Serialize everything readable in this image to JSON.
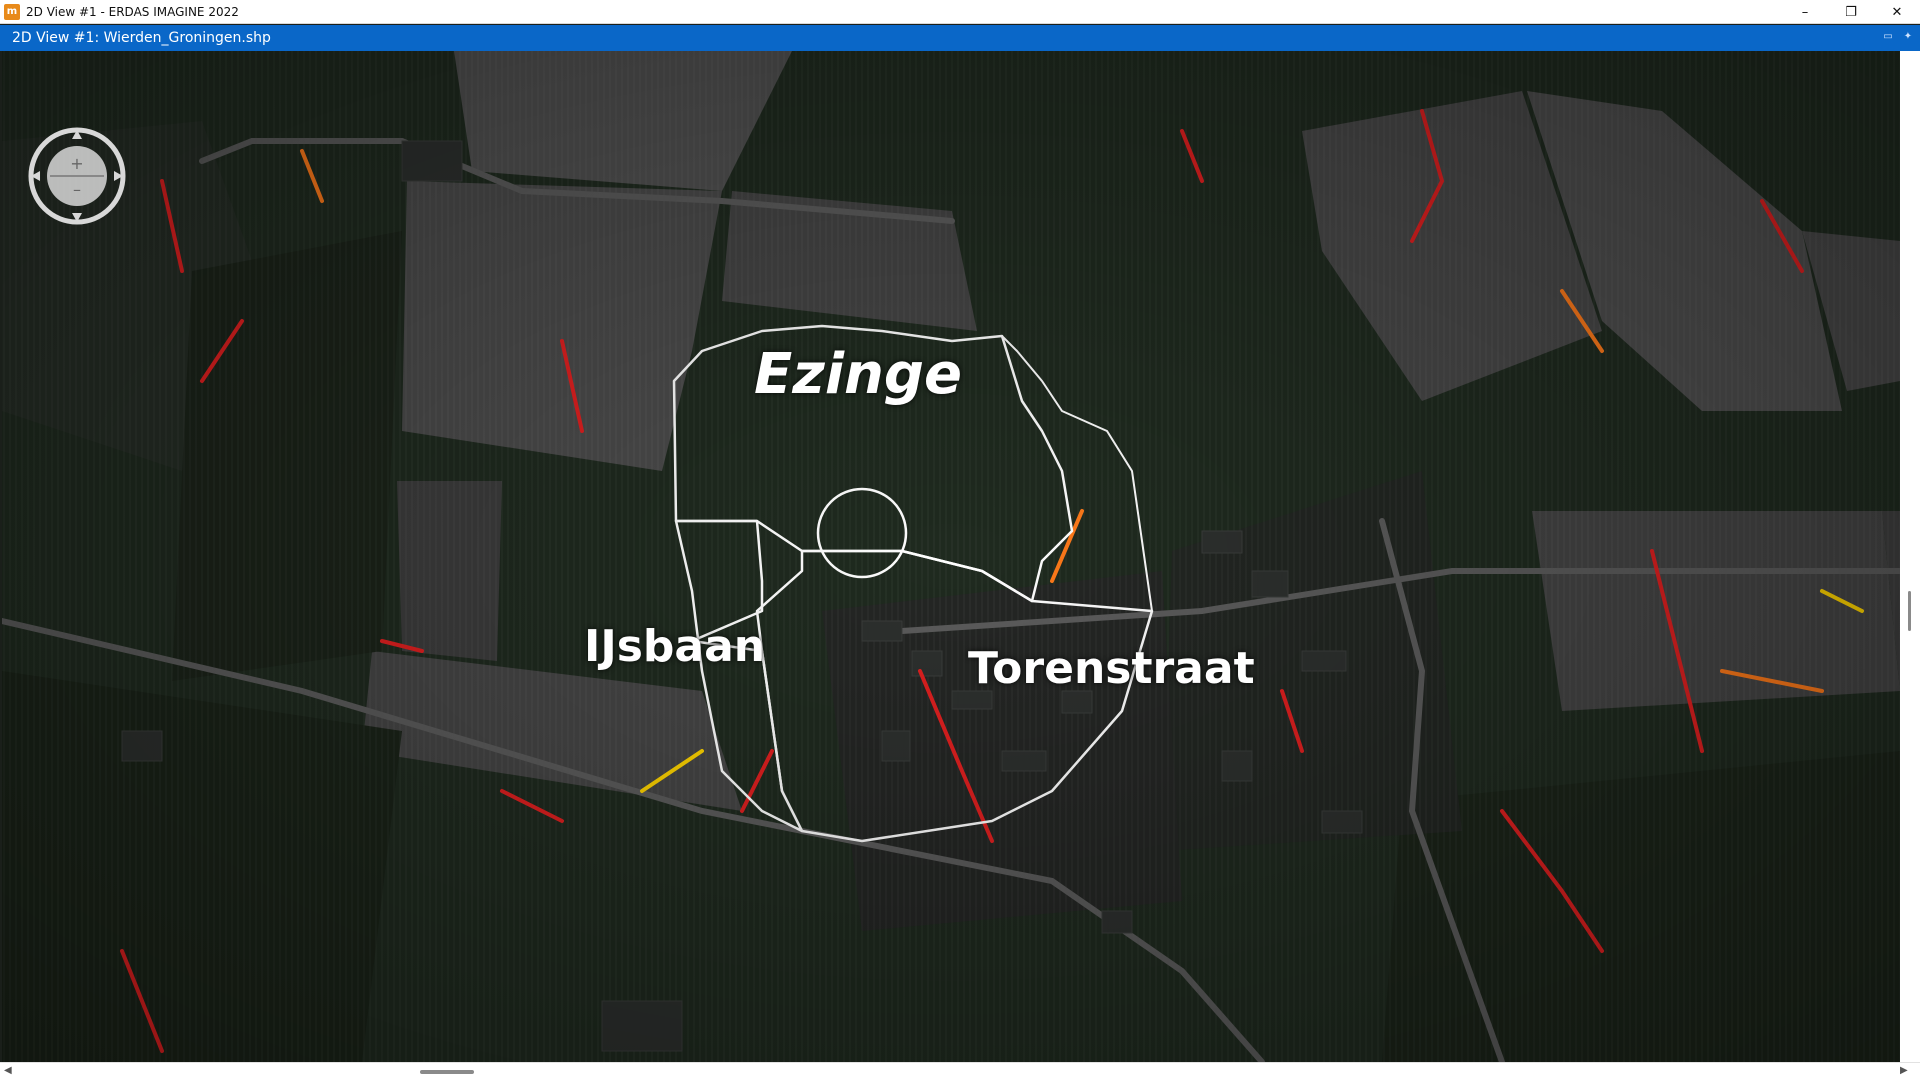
{
  "window": {
    "title": "2D View #1 - ERDAS IMAGINE 2022",
    "app_icon_letter": "m",
    "controls": {
      "minimize": "–",
      "restore": "❐",
      "close": "✕"
    }
  },
  "view": {
    "title": "2D View #1: Wierden_Groningen.shp"
  },
  "map": {
    "labels": {
      "ezinge": "Ezinge",
      "ijsbaan": "IJsbaan",
      "torenstraat": "Torenstraat"
    },
    "colors": {
      "boundary": "#ffffff",
      "edge_strong": "#e02020",
      "edge_medium": "#ff7a1a",
      "edge_weak": "#ffd400",
      "pasture": "#1f2b1f",
      "fields_light": "#4a4a4a"
    },
    "nav_widget": {
      "zoom_in": "+",
      "zoom_out": "–"
    }
  },
  "scrollbars": {
    "left_arrow": "◀",
    "right_arrow": "▶"
  }
}
